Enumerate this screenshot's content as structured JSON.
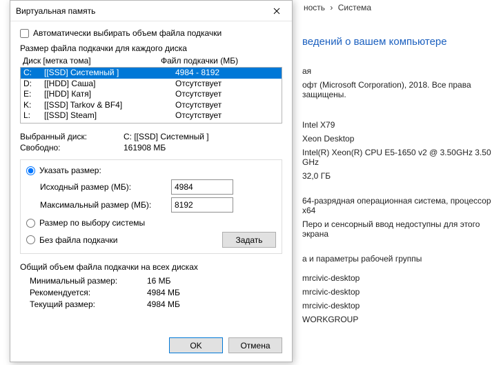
{
  "background": {
    "breadcrumb_part1": "ность",
    "breadcrumb_sep": "›",
    "breadcrumb_part2": "Система",
    "heading_partial": "ведений о вашем компьютере",
    "rows": {
      "r1": "ая",
      "r2": "офт (Microsoft Corporation), 2018. Все права защищены.",
      "r3": "Intel X79",
      "r4": "Xeon Desktop",
      "r5": "Intel(R) Xeon(R) CPU E5-1650 v2 @ 3.50GHz   3.50 GHz",
      "r6": "32,0 ГБ",
      "r7": "64-разрядная операционная система, процессор x64",
      "r8": "Перо и сенсорный ввод недоступны для этого экрана",
      "r9": "а и параметры рабочей группы",
      "r10": "mrcivic-desktop",
      "r11": "mrcivic-desktop",
      "r12": "mrcivic-desktop",
      "r13": "WORKGROUP"
    }
  },
  "dialog": {
    "title": "Виртуальная память",
    "auto_checkbox_label": "Автоматически выбирать объем файла подкачки",
    "auto_checked": false,
    "section_drives": "Размер файла подкачки для каждого диска",
    "header_disk": "Диск [метка тома]",
    "header_page": "Файл подкачки (МБ)",
    "drives": [
      {
        "letter": "C:",
        "label": "[[SSD] Системный ]",
        "page": "4984 - 8192",
        "selected": true
      },
      {
        "letter": "D:",
        "label": "[[HDD] Саша]",
        "page": "Отсутствует",
        "selected": false
      },
      {
        "letter": "E:",
        "label": "[[HDD] Катя]",
        "page": "Отсутствует",
        "selected": false
      },
      {
        "letter": "K:",
        "label": "[[SSD] Tarkov & BF4]",
        "page": "Отсутствует",
        "selected": false
      },
      {
        "letter": "L:",
        "label": "[[SSD] Steam]",
        "page": "Отсутствует",
        "selected": false
      }
    ],
    "selected_disk_label": "Выбранный диск:",
    "selected_disk_value": "C:  [[SSD] Системный ]",
    "free_label": "Свободно:",
    "free_value": "161908 МБ",
    "radio_custom": "Указать размер:",
    "initial_size_label": "Исходный размер (МБ):",
    "initial_size_value": "4984",
    "max_size_label": "Максимальный размер (МБ):",
    "max_size_value": "8192",
    "radio_system": "Размер по выбору системы",
    "radio_none": "Без файла подкачки",
    "set_button": "Задать",
    "totals_section": "Общий объем файла подкачки на всех дисках",
    "min_label": "Минимальный размер:",
    "min_value": "16 МБ",
    "rec_label": "Рекомендуется:",
    "rec_value": "4984 МБ",
    "cur_label": "Текущий размер:",
    "cur_value": "4984 МБ",
    "ok": "OK",
    "cancel": "Отмена"
  }
}
